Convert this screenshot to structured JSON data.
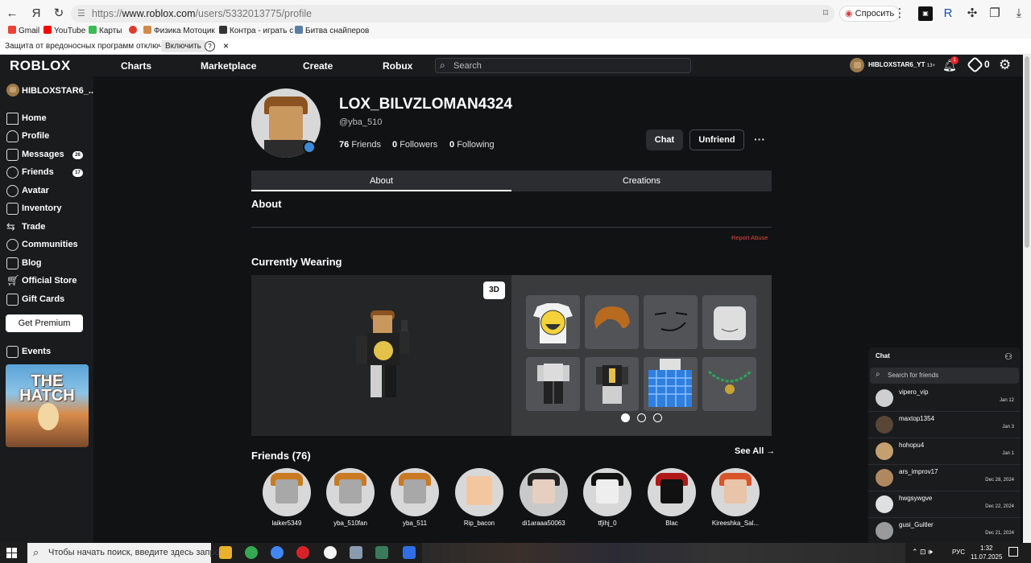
{
  "browser": {
    "url_prefix": "https://",
    "url_domain": "www.roblox.com",
    "url_path": "/users/5332013775/profile",
    "ask_label": "Спросить",
    "bookmarks": [
      "Gmail",
      "YouTube",
      "Карты",
      "Физика Мотоцик",
      "Контра - играть с",
      "Битва снайперов"
    ],
    "infobar_text": "Защита от вредоносных программ отключена",
    "infobar_button": "Включить",
    "infobar_help": "?",
    "infobar_close": "×"
  },
  "topbar": {
    "logo": "ROBLOX",
    "links": [
      "Charts",
      "Marketplace",
      "Create",
      "Robux"
    ],
    "search_placeholder": "Search",
    "user": "HIBLOXSTAR6_YT",
    "age_tag": "13+",
    "notification_count": "1",
    "robux": "0"
  },
  "sidebar": {
    "user": "HIBLOXSTAR6_...",
    "items": [
      {
        "label": "Home"
      },
      {
        "label": "Profile"
      },
      {
        "label": "Messages",
        "badge": "26"
      },
      {
        "label": "Friends",
        "badge": "17"
      },
      {
        "label": "Avatar"
      },
      {
        "label": "Inventory"
      },
      {
        "label": "Trade"
      },
      {
        "label": "Communities"
      },
      {
        "label": "Blog"
      },
      {
        "label": "Official Store"
      },
      {
        "label": "Gift Cards"
      }
    ],
    "premium": "Get Premium",
    "events": "Events",
    "promo": "THE HATCH"
  },
  "profile": {
    "display_name": "LOX_BILVZLOMAN4324",
    "username": "@yba_510",
    "friends_count": "76",
    "friends_label": "Friends",
    "followers_count": "0",
    "followers_label": "Followers",
    "following_count": "0",
    "following_label": "Following",
    "chat": "Chat",
    "unfriend": "Unfriend",
    "more": "···"
  },
  "tabs": [
    "About",
    "Creations"
  ],
  "about": {
    "heading": "About",
    "report": "Report Abuse"
  },
  "wearing": {
    "heading": "Currently Wearing",
    "btn_3d": "3D"
  },
  "friends": {
    "heading": "Friends (76)",
    "see_all": "See All →",
    "list": [
      "laiker5349",
      "yba_510fan",
      "yba_511",
      "Rip_bacon",
      "di1araaa50063",
      "tfjihj_0",
      "Blac",
      "Kireeshka_Sal..."
    ]
  },
  "chat": {
    "title": "Chat",
    "search_placeholder": "Search for friends",
    "rows": [
      {
        "name": "vipero_vip",
        "date": "Jan 12"
      },
      {
        "name": "maxtop1354",
        "date": "Jan 3"
      },
      {
        "name": "hohopu4",
        "date": "Jan 1"
      },
      {
        "name": "ars_improv17",
        "date": "Dec 28, 2024"
      },
      {
        "name": "hwgsywgve",
        "date": "Dec 22, 2024"
      },
      {
        "name": "gusi_Guitler",
        "date": "Dec 21, 2024"
      }
    ]
  },
  "taskbar": {
    "search_placeholder": "Чтобы начать поиск, введите здесь запрос",
    "lang": "РУС",
    "time": "1:32",
    "date": "11.07.2025"
  },
  "colors": {
    "page_bg": "#111214",
    "panel_bg": "#191b1d",
    "report": "#e24a3b",
    "online": "#3c8bd8"
  }
}
